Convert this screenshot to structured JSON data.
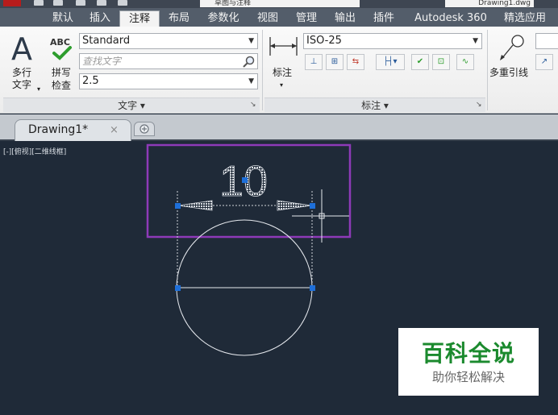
{
  "title_bar": {
    "workspace": "草图与注释",
    "file_name": "Drawing1.dwg"
  },
  "ribbon_tabs": [
    "默认",
    "插入",
    "注释",
    "布局",
    "参数化",
    "视图",
    "管理",
    "输出",
    "插件",
    "Autodesk 360",
    "精选应用"
  ],
  "active_tab": "注释",
  "text_panel": {
    "mtext_label_1": "多行",
    "mtext_label_2": "文字",
    "spell_label_1": "拼写",
    "spell_label_2": "检查",
    "abc_label": "ABC",
    "text_style": "Standard",
    "find_placeholder": "查找文字",
    "text_height": "2.5",
    "title": "文字 ▾"
  },
  "dimension_panel": {
    "dim_label": "标注",
    "dim_style": "ISO-25",
    "title": "标注 ▾"
  },
  "leader_panel": {
    "mleader_label": "多重引线"
  },
  "file_tab": {
    "name": "Drawing1*",
    "close": "×"
  },
  "viewport": {
    "label": "[-][俯视][二维线框]",
    "dimension_text": "10"
  },
  "watermark": {
    "title": "百科全说",
    "subtitle": "助你轻松解决"
  },
  "colors": {
    "canvas": "#1f2a38",
    "highlight_box": "#8e3ab8",
    "grip": "#1e6fd9",
    "watermark_green": "#1b8a2e"
  }
}
